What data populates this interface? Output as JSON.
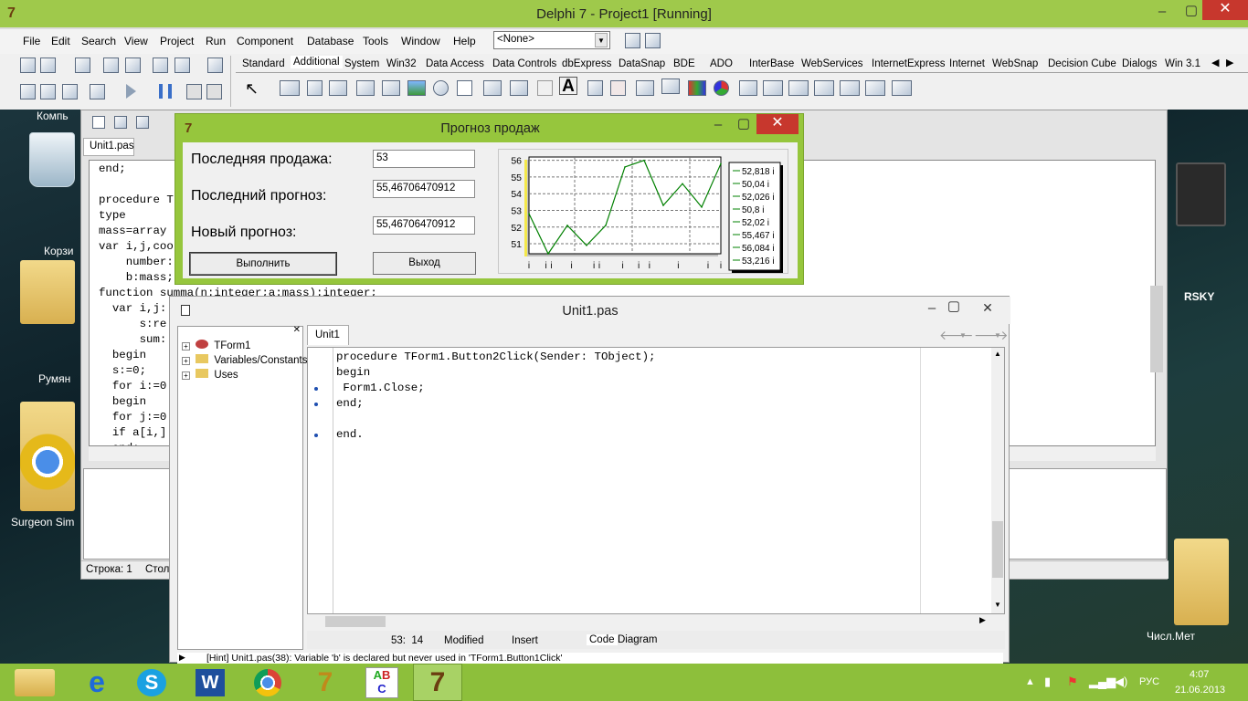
{
  "window_title": "Delphi 7 - Project1 [Running]",
  "menu": [
    "File",
    "Edit",
    "Search",
    "View",
    "Project",
    "Run",
    "Component",
    "Database",
    "Tools",
    "Window",
    "Help"
  ],
  "combo_value": "<None>",
  "palette_tabs": [
    "Standard",
    "Additional",
    "System",
    "Win32",
    "Data Access",
    "Data Controls",
    "dbExpress",
    "DataSnap",
    "BDE",
    "ADO",
    "InterBase",
    "WebServices",
    "InternetExpress",
    "Internet",
    "WebSnap",
    "Decision Cube",
    "Dialogs",
    "Win 3.1"
  ],
  "desktop_icons": [
    "Компь",
    "Корзи",
    "Румян",
    "Surgeon Sim",
    "Числ.Мет",
    "RSKY"
  ],
  "bg_editor": {
    "tab": "Unit1.pas",
    "lines": [
      "end;",
      "",
      "procedure T",
      "type",
      "mass=array",
      "var i,j,coo",
      "    number:",
      "    b:mass;",
      "function summa(n:integer;a:mass):integer;",
      "  var i,j:",
      "      s:re",
      "      sum:",
      "  begin",
      "  s:=0;",
      "  for i:=0",
      "  begin",
      "  for j:=0",
      "  if a[i,]",
      "  end;"
    ],
    "status_line": "Строка: 1",
    "status_col": "Стол"
  },
  "form": {
    "title": "Прогноз продаж",
    "label1": "Последняя продажа:",
    "label2": "Последний прогноз:",
    "label3": "Новый прогноз:",
    "edit1": "53",
    "edit2": "55,46706470912",
    "edit3": "55,46706470912",
    "button_run": "Выполнить",
    "button_exit": "Выход"
  },
  "chart_data": {
    "type": "line",
    "x": [
      1,
      2,
      3,
      4,
      5,
      6,
      7,
      8,
      9,
      10,
      11
    ],
    "values": [
      52.8,
      50.4,
      52.1,
      50.9,
      52.1,
      55.6,
      56.0,
      53.3,
      54.6,
      53.2,
      55.8
    ],
    "yticks": [
      "56",
      "55",
      "54",
      "53",
      "52",
      "51"
    ],
    "ylim": [
      50.4,
      56.2
    ],
    "xtick_label": "i",
    "legend": [
      "52,818 i",
      "50,04 i",
      "52,026 i",
      "50,8 i",
      "52,02 i",
      "55,467 i",
      "56,084 i",
      "53,216 i"
    ],
    "grid": true,
    "color": "#008000"
  },
  "unit_window": {
    "title": "Unit1.pas",
    "tab": "Unit1",
    "tree": [
      "TForm1",
      "Variables/Constants",
      "Uses"
    ],
    "code": [
      "procedure TForm1.Button2Click(Sender: TObject);",
      "begin",
      " Form1.Close;",
      "end;",
      "",
      "end."
    ],
    "status_pos": "53:  14",
    "status_mod": "Modified",
    "status_ins": "Insert",
    "tab_code": "Code",
    "tab_diagram": "Diagram",
    "hint": "[Hint] Unit1.pas(38): Variable 'b' is declared but never used in 'TForm1.Button1Click'"
  },
  "tray": {
    "lang": "РУС",
    "time": "4:07",
    "date": "21.06.2013"
  },
  "colors": {
    "taskbar": "#8dbf3b",
    "form_frame": "#96c63d",
    "close": "#c7372d"
  }
}
